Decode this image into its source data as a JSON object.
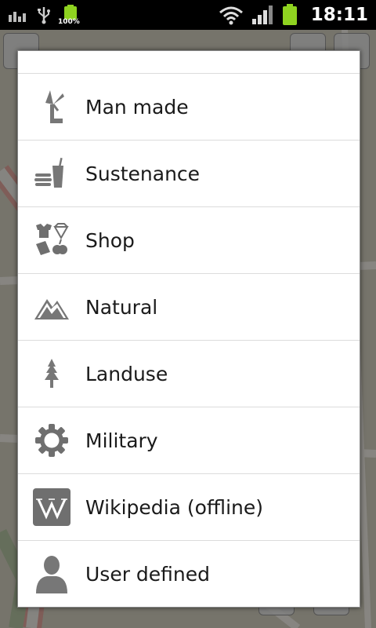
{
  "status_bar": {
    "battery_percent": "100%",
    "time": "18:11",
    "icons": [
      "signal-bars-icon",
      "usb-icon",
      "battery-icon",
      "wifi-icon",
      "cell-signal-icon",
      "battery-full-icon"
    ]
  },
  "colors": {
    "battery_green": "#8fd320",
    "icon_gray": "#6f6f6f",
    "text": "#1a1a1a",
    "divider": "#dcdcdc"
  },
  "poi_list": {
    "items": [
      {
        "label": "Man made",
        "icon": "windmill-icon"
      },
      {
        "label": "Sustenance",
        "icon": "food-drink-icon"
      },
      {
        "label": "Shop",
        "icon": "shop-icon"
      },
      {
        "label": "Natural",
        "icon": "mountain-icon"
      },
      {
        "label": "Landuse",
        "icon": "tree-icon"
      },
      {
        "label": "Military",
        "icon": "gear-icon"
      },
      {
        "label": "Wikipedia (offline)",
        "icon": "wikipedia-icon"
      },
      {
        "label": "User defined",
        "icon": "person-icon"
      }
    ]
  }
}
